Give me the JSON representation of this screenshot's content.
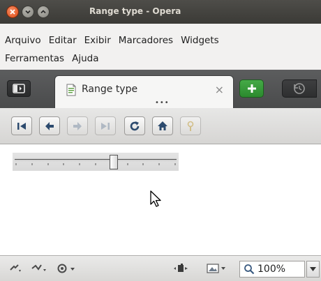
{
  "window": {
    "title": "Range type - Opera"
  },
  "menubar": {
    "row1": [
      {
        "label": "Arquivo"
      },
      {
        "label": "Editar"
      },
      {
        "label": "Exibir"
      },
      {
        "label": "Marcadores"
      },
      {
        "label": "Widgets"
      }
    ],
    "row2": [
      {
        "label": "Ferramentas"
      },
      {
        "label": "Ajuda"
      }
    ]
  },
  "tabs": {
    "active": {
      "title": "Range type",
      "close_glyph": "×",
      "favicon": "page-icon"
    },
    "new_tab_glyph": "+",
    "dots": "•••"
  },
  "toolbar": {
    "buttons": [
      {
        "name": "rewind-icon",
        "enabled": true
      },
      {
        "name": "back-icon",
        "enabled": true
      },
      {
        "name": "forward-icon",
        "enabled": false
      },
      {
        "name": "fast-forward-icon",
        "enabled": false
      },
      {
        "name": "reload-icon",
        "enabled": true
      },
      {
        "name": "home-icon",
        "enabled": true
      },
      {
        "name": "wand-icon",
        "enabled": false
      }
    ]
  },
  "content": {
    "range": {
      "min": 0,
      "max": 100,
      "value": 62,
      "tick_count": 11
    }
  },
  "statusbar": {
    "zoom": "100%",
    "icons": [
      "speed-dial-icon",
      "network-icon",
      "opera-unite-icon",
      "turbo-icon",
      "image-mode-icon"
    ]
  },
  "colors": {
    "titlebar": "#3b3a36",
    "close_button": "#de4b16",
    "new_tab": "#2b8a2e"
  }
}
